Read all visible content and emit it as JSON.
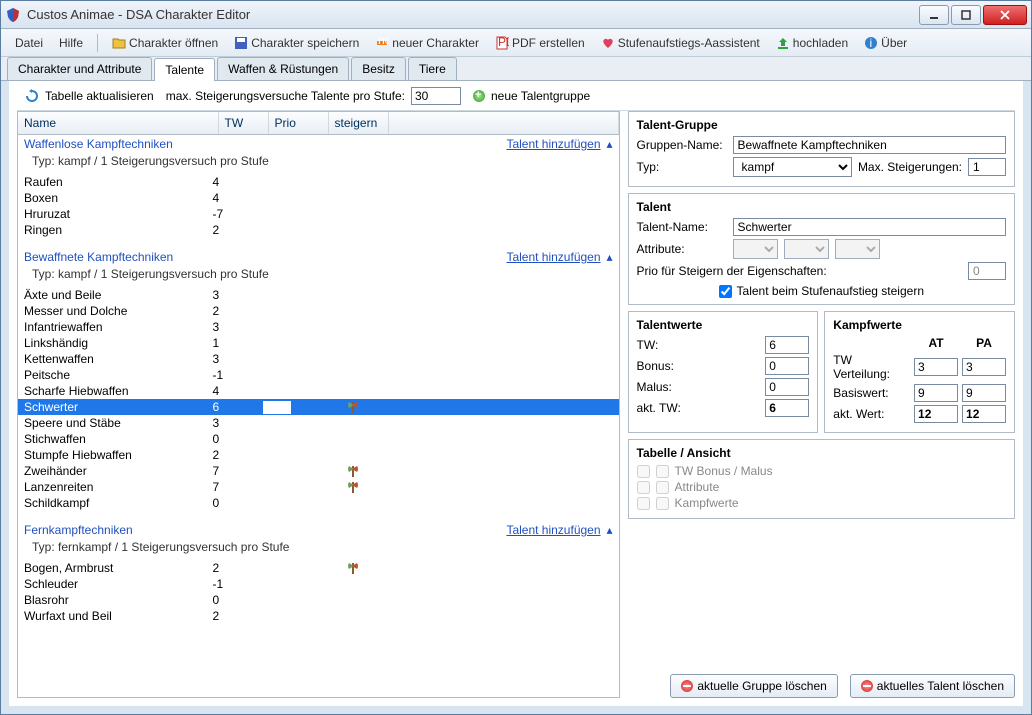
{
  "window": {
    "title": "Custos Animae - DSA Charakter Editor"
  },
  "menu": {
    "datei": "Datei",
    "hilfe": "Hilfe"
  },
  "toolbar": {
    "open": "Charakter öffnen",
    "save": "Charakter speichern",
    "new": "neuer Charakter",
    "pdf": "PDF erstellen",
    "assist": "Stufenaufstiegs-Aassistent",
    "upload": "hochladen",
    "about": "Über"
  },
  "tabs": {
    "t1": "Charakter und Attribute",
    "t2": "Talente",
    "t3": "Waffen & Rüstungen",
    "t4": "Besitz",
    "t5": "Tiere"
  },
  "toolbar2": {
    "refresh": "Tabelle aktualisieren",
    "maxlabel": "max. Steigerungsversuche Talente pro Stufe:",
    "maxval": "30",
    "newgroup": "neue Talentgruppe"
  },
  "cols": {
    "name": "Name",
    "tw": "TW",
    "prio": "Prio",
    "steig": "steigern"
  },
  "addlink": "Talent hinzufügen",
  "groups": [
    {
      "name": "Waffenlose Kampftechniken",
      "sub": "Typ: kampf / 1 Steigerungsversuch pro Stufe",
      "rows": [
        {
          "n": "Raufen",
          "tw": "4"
        },
        {
          "n": "Boxen",
          "tw": "4"
        },
        {
          "n": "Hruruzat",
          "tw": "-7"
        },
        {
          "n": "Ringen",
          "tw": "2"
        }
      ]
    },
    {
      "name": "Bewaffnete Kampftechniken",
      "sub": "Typ: kampf / 1 Steigerungsversuch pro Stufe",
      "rows": [
        {
          "n": "Äxte und Beile",
          "tw": "3"
        },
        {
          "n": "Messer und Dolche",
          "tw": "2"
        },
        {
          "n": "Infantriewaffen",
          "tw": "3"
        },
        {
          "n": "Linkshändig",
          "tw": "1"
        },
        {
          "n": "Kettenwaffen",
          "tw": "3"
        },
        {
          "n": "Peitsche",
          "tw": "-1"
        },
        {
          "n": "Scharfe Hiebwaffen",
          "tw": "4"
        },
        {
          "n": "Schwerter",
          "tw": "6",
          "sel": true,
          "axe": true
        },
        {
          "n": "Speere und Stäbe",
          "tw": "3"
        },
        {
          "n": "Stichwaffen",
          "tw": "0"
        },
        {
          "n": "Stumpfe Hiebwaffen",
          "tw": "2"
        },
        {
          "n": "Zweihänder",
          "tw": "7",
          "axe": true
        },
        {
          "n": "Lanzenreiten",
          "tw": "7",
          "axe": true
        },
        {
          "n": "Schildkampf",
          "tw": "0"
        }
      ]
    },
    {
      "name": "Fernkampftechniken",
      "sub": "Typ: fernkampf / 1 Steigerungsversuch pro Stufe",
      "rows": [
        {
          "n": "Bogen, Armbrust",
          "tw": "2",
          "axe": true
        },
        {
          "n": "Schleuder",
          "tw": "-1"
        },
        {
          "n": "Blasrohr",
          "tw": "0"
        },
        {
          "n": "Wurfaxt und Beil",
          "tw": "2"
        }
      ]
    }
  ],
  "right": {
    "group": {
      "title": "Talent-Gruppe",
      "name_l": "Gruppen-Name:",
      "name_v": "Bewaffnete Kampftechniken",
      "typ_l": "Typ:",
      "typ_v": "kampf",
      "max_l": "Max. Steigerungen:",
      "max_v": "1"
    },
    "talent": {
      "title": "Talent",
      "name_l": "Talent-Name:",
      "name_v": "Schwerter",
      "attr_l": "Attribute:",
      "prio_l": "Prio für Steigern der Eigenschaften:",
      "prio_v": "0",
      "chk_l": "Talent beim Stufenaufstieg steigern"
    },
    "tw": {
      "title": "Talentwerte",
      "tw_l": "TW:",
      "tw_v": "6",
      "bonus_l": "Bonus:",
      "bonus_v": "0",
      "malus_l": "Malus:",
      "malus_v": "0",
      "akt_l": "akt. TW:",
      "akt_v": "6"
    },
    "kw": {
      "title": "Kampfwerte",
      "at": "AT",
      "pa": "PA",
      "vert_l": "TW Verteilung:",
      "vert_at": "3",
      "vert_pa": "3",
      "basis_l": "Basiswert:",
      "basis_at": "9",
      "basis_pa": "9",
      "akt_l": "akt. Wert:",
      "akt_at": "12",
      "akt_pa": "12"
    },
    "view": {
      "title": "Tabelle / Ansicht",
      "c1": "TW Bonus / Malus",
      "c2": "Attribute",
      "c3": "Kampfwerte"
    },
    "btn1": "aktuelle Gruppe löschen",
    "btn2": "aktuelles Talent löschen"
  }
}
